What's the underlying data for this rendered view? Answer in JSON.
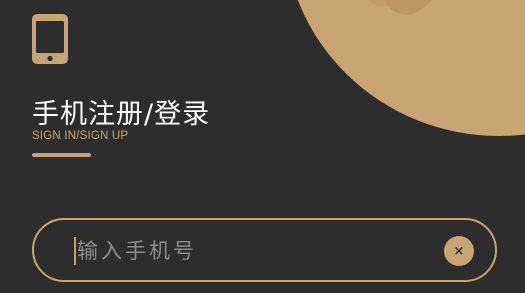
{
  "header": {
    "phone_icon": "mobile-phone-icon",
    "title": "手机注册/登录",
    "subtitle": "SIGN IN/SIGN UP"
  },
  "phone_input": {
    "placeholder": "输入手机号",
    "value": "",
    "clear_icon": "close-icon",
    "clear_symbol": "×"
  },
  "colors": {
    "background": "#2e2d2d",
    "accent": "#c8a473",
    "title_text": "#ffffff",
    "placeholder_text": "#8d8d8d"
  }
}
